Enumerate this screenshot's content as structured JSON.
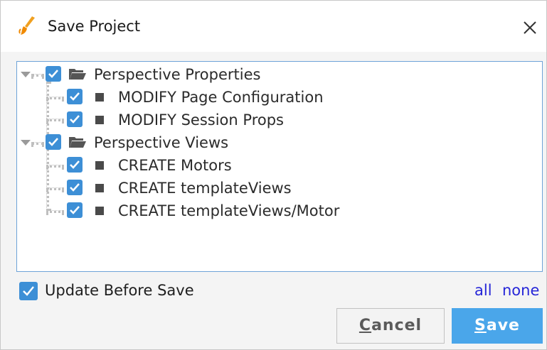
{
  "window": {
    "title": "Save Project",
    "icon": "brush-icon",
    "close_icon": "close-icon"
  },
  "tree": {
    "groups": [
      {
        "label": "Perspective Properties",
        "checked": true,
        "expanded": true,
        "items": [
          {
            "label": "MODIFY Page Configuration",
            "checked": true
          },
          {
            "label": "MODIFY Session Props",
            "checked": true
          }
        ]
      },
      {
        "label": "Perspective Views",
        "checked": true,
        "expanded": true,
        "items": [
          {
            "label": "CREATE Motors",
            "checked": true
          },
          {
            "label": "CREATE templateViews",
            "checked": true
          },
          {
            "label": "CREATE templateViews/Motor",
            "checked": true
          }
        ]
      }
    ]
  },
  "update_before_save": {
    "label": "Update Before Save",
    "checked": true
  },
  "select_links": {
    "all": "all",
    "none": "none"
  },
  "buttons": {
    "cancel": {
      "mnemonic": "C",
      "rest": "ancel"
    },
    "save": {
      "mnemonic": "S",
      "rest": "ave"
    }
  },
  "colors": {
    "accent": "#3d8fd6",
    "save_button": "#4aa6ea",
    "link": "#2626d8",
    "tree_border": "#6ea3d8"
  }
}
